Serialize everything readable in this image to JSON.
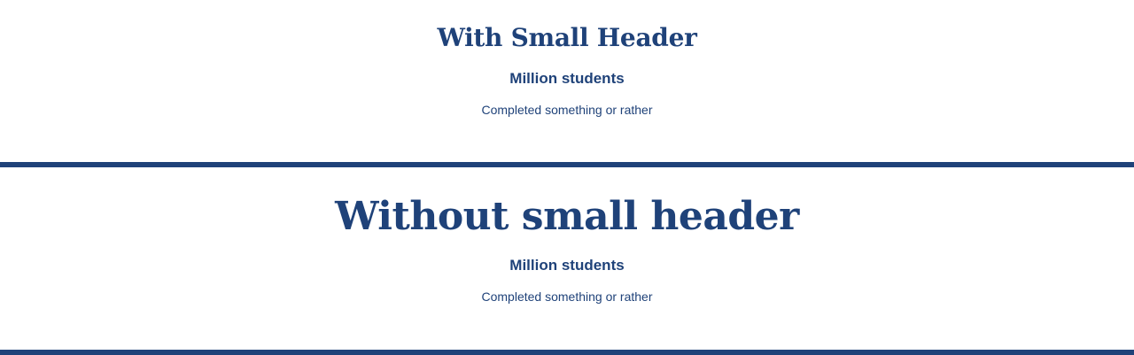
{
  "sections": [
    {
      "heading": "With Small Header",
      "label": "Million students",
      "description": "Completed something or rather"
    },
    {
      "heading": "Without small header",
      "label": "Million students",
      "description": "Completed something or rather"
    }
  ],
  "colors": {
    "text": "#1f4279",
    "divider": "#1f4279",
    "background": "#ffffff"
  }
}
